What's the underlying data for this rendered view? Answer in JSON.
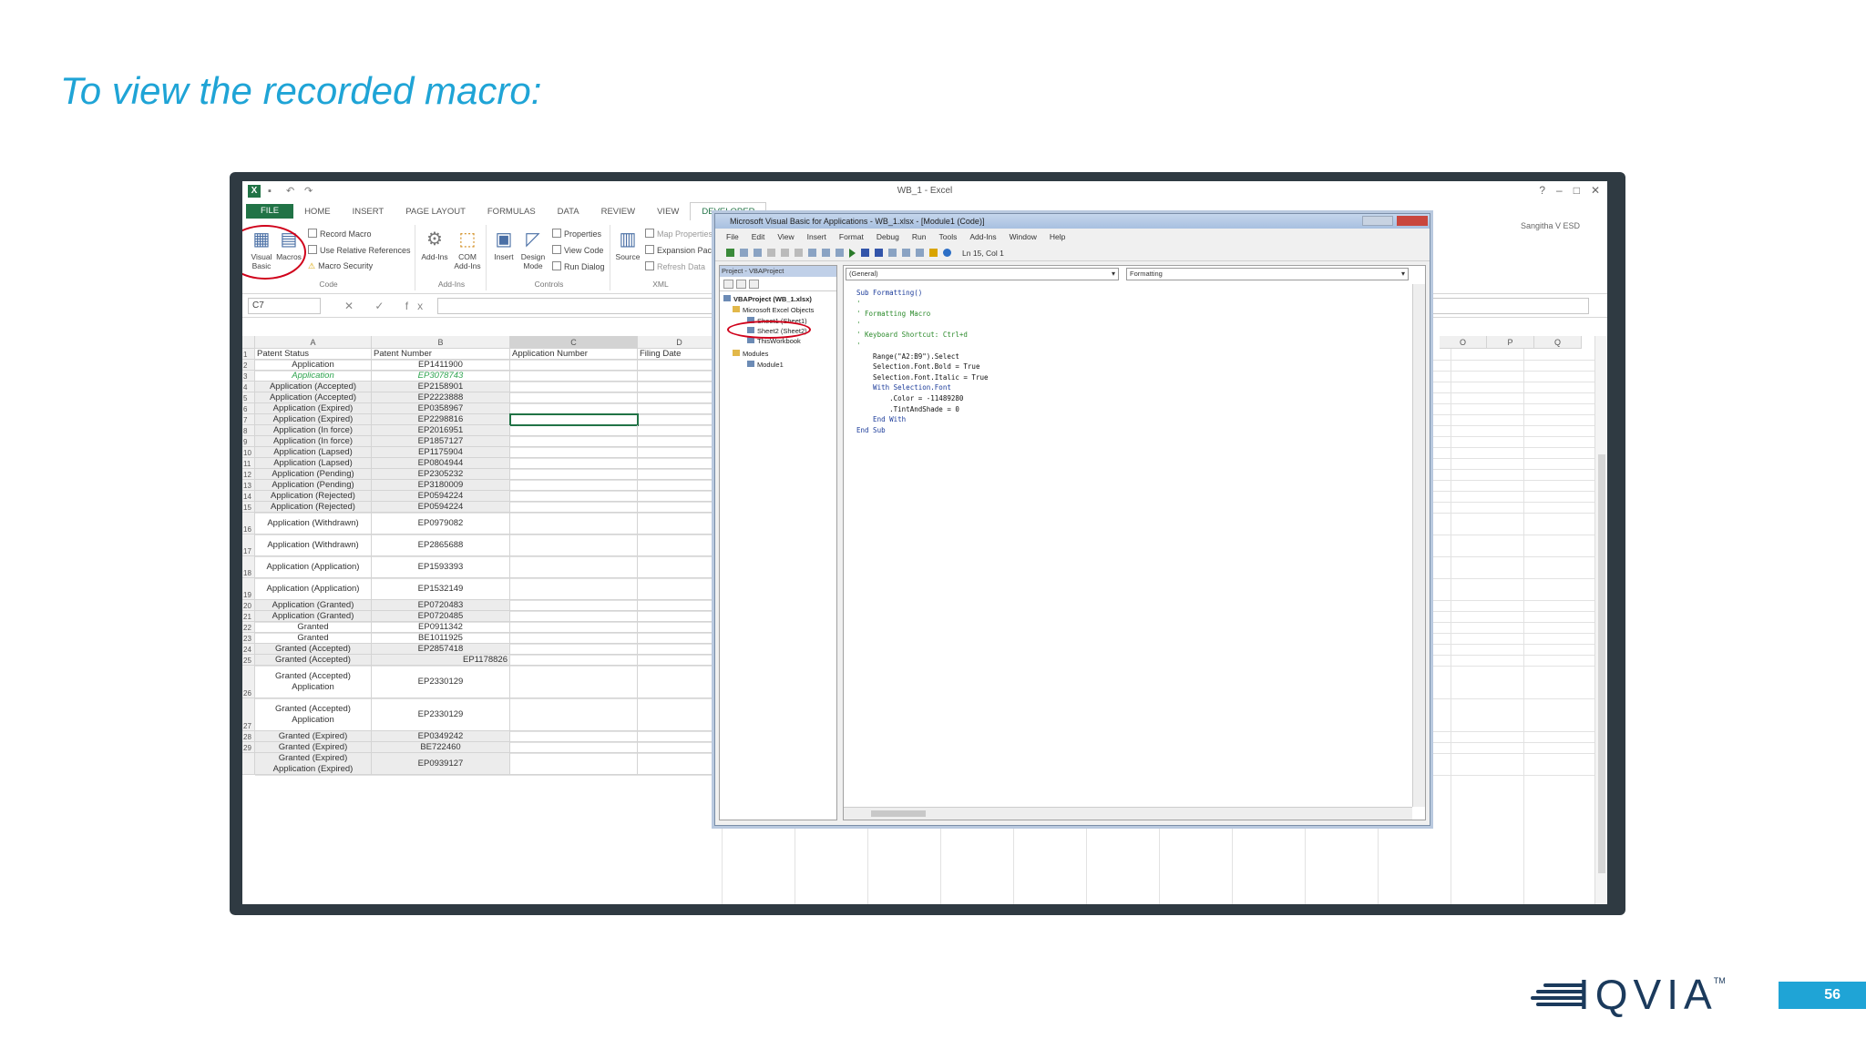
{
  "slide": {
    "title": "To view the recorded macro:",
    "page_number": "56",
    "brand": "IQVIA",
    "trademark": "TM"
  },
  "excel": {
    "window_title": "WB_1 - Excel",
    "user": "Sangitha V ESD",
    "tabs": [
      "FILE",
      "HOME",
      "INSERT",
      "PAGE LAYOUT",
      "FORMULAS",
      "DATA",
      "REVIEW",
      "VIEW",
      "DEVELOPER"
    ],
    "active_tab": "DEVELOPER",
    "ribbon": {
      "code_group": {
        "label": "Code",
        "visual_basic": "Visual Basic",
        "macros": "Macros",
        "record_macro": "Record Macro",
        "relative_refs": "Use Relative References",
        "macro_security": "Macro Security"
      },
      "addins_group": {
        "label": "Add-Ins",
        "addins": "Add-Ins",
        "com_addins": "COM Add-Ins"
      },
      "controls_group": {
        "label": "Controls",
        "insert": "Insert",
        "design_mode": "Design Mode",
        "properties": "Properties",
        "view_code": "View Code",
        "run_dialog": "Run Dialog"
      },
      "xml_group": {
        "label": "XML",
        "source": "Source",
        "map_properties": "Map Properties",
        "expansion_packs": "Expansion Packs",
        "refresh_data": "Refresh Data"
      }
    },
    "name_box": "C7",
    "fx_symbols": "✕ ✓ fx",
    "columns": [
      "A",
      "B",
      "C",
      "D",
      "O",
      "P",
      "Q"
    ],
    "headers": {
      "a": "Patent Status",
      "b": "Patent Number",
      "c": "Application Number",
      "d": "Filing Date"
    },
    "rows": [
      {
        "n": "2",
        "a": "Application",
        "b": "EP1411900"
      },
      {
        "n": "3",
        "a": "Application",
        "b": "EP3078743"
      },
      {
        "n": "4",
        "a": "Application (Accepted)",
        "b": "EP2158901"
      },
      {
        "n": "5",
        "a": "Application (Accepted)",
        "b": "EP2223888"
      },
      {
        "n": "6",
        "a": "Application (Expired)",
        "b": "EP0358967"
      },
      {
        "n": "7",
        "a": "Application (Expired)",
        "b": "EP2298816"
      },
      {
        "n": "8",
        "a": "Application (In force)",
        "b": "EP2016951"
      },
      {
        "n": "9",
        "a": "Application (In force)",
        "b": "EP1857127"
      },
      {
        "n": "10",
        "a": "Application (Lapsed)",
        "b": "EP1175904"
      },
      {
        "n": "11",
        "a": "Application (Lapsed)",
        "b": "EP0804944"
      },
      {
        "n": "12",
        "a": "Application (Pending)",
        "b": "EP2305232"
      },
      {
        "n": "13",
        "a": "Application (Pending)",
        "b": "EP3180009"
      },
      {
        "n": "14",
        "a": "Application (Rejected)",
        "b": "EP0594224"
      },
      {
        "n": "15",
        "a": "Application (Rejected)",
        "b": "EP0594224"
      },
      {
        "n": "16",
        "a": "Application (Withdrawn)",
        "b": "EP0979082"
      },
      {
        "n": "17",
        "a": "Application (Withdrawn)",
        "b": "EP2865688"
      },
      {
        "n": "18",
        "a": "Application (Application)",
        "b": "EP1593393"
      },
      {
        "n": "19",
        "a": "Application (Application)",
        "b": "EP1532149"
      },
      {
        "n": "20",
        "a": "Application (Granted)",
        "b": "EP0720483"
      },
      {
        "n": "21",
        "a": "Application (Granted)",
        "b": "EP0720485"
      },
      {
        "n": "22",
        "a": "Granted",
        "b": "EP0911342"
      },
      {
        "n": "23",
        "a": "Granted",
        "b": "BE1011925"
      },
      {
        "n": "24",
        "a": "Granted (Accepted)",
        "b": "EP2857418"
      },
      {
        "n": "25",
        "a": "Granted (Accepted)",
        "b": "EP1178826"
      },
      {
        "n": "26",
        "a": "Granted (Accepted) Application",
        "b": "EP2330129"
      },
      {
        "n": "27",
        "a": "Granted (Accepted) Application",
        "b": "EP2330129"
      },
      {
        "n": "28",
        "a": "Granted (Expired)",
        "b": "EP0349242"
      },
      {
        "n": "29",
        "a": "Granted (Expired)",
        "b": "BE722460"
      },
      {
        "n": "",
        "a": "Granted (Expired) Application (Expired)",
        "b": "EP0939127"
      }
    ]
  },
  "vba": {
    "window_title": "Microsoft Visual Basic for Applications - WB_1.xlsx - [Module1 (Code)]",
    "menu": [
      "File",
      "Edit",
      "View",
      "Insert",
      "Format",
      "Debug",
      "Run",
      "Tools",
      "Add-Ins",
      "Window",
      "Help"
    ],
    "position": "Ln 15, Col 1",
    "project_title": "Project - VBAProject",
    "tree": {
      "project": "VBAProject (WB_1.xlsx)",
      "objects_folder": "Microsoft Excel Objects",
      "sheet1": "Sheet1 (Sheet1)",
      "sheet2": "Sheet2 (Sheet2)",
      "workbook": "ThisWorkbook",
      "modules_folder": "Modules",
      "module1": "Module1"
    },
    "combo_object": "(General)",
    "combo_proc": "Formatting",
    "code_lines": [
      "Sub Formatting()",
      "'",
      "' Formatting Macro",
      "'",
      "' Keyboard Shortcut: Ctrl+d",
      "'",
      "    Range(\"A2:B9\").Select",
      "    Selection.Font.Bold = True",
      "    Selection.Font.Italic = True",
      "    With Selection.Font",
      "        .Color = -11489280",
      "        .TintAndShade = 0",
      "    End With",
      "End Sub"
    ]
  }
}
